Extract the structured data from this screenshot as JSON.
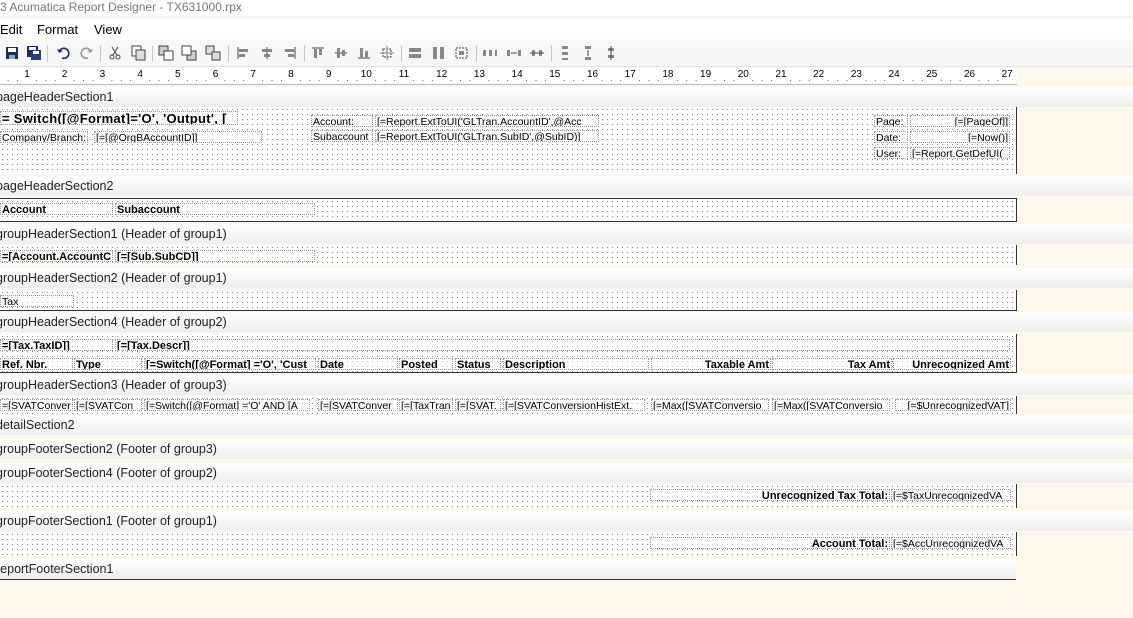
{
  "window": {
    "title": "3 Acumatica Report Designer - TX631000.rpx"
  },
  "menu": [
    "Edit",
    "Format",
    "View"
  ],
  "ruler": {
    "numbers": [
      "1",
      "2",
      "3",
      "4",
      "5",
      "6",
      "7",
      "8",
      "9",
      "10",
      "11",
      "12",
      "13",
      "14",
      "15",
      "16",
      "17",
      "18",
      "19",
      "20",
      "21",
      "22",
      "23",
      "24",
      "25",
      "26",
      "27"
    ]
  },
  "sections": {
    "pageHeader1": {
      "label": "pageHeaderSection1",
      "fields": {
        "switch": "=  Switch([@Format]='O',  'Output',  [",
        "company_label": "Company/Branch:",
        "company_val": "[=[@OrgBAccountID]]",
        "account_label": "Account:",
        "account_val": "[=Report.ExtToUI('GLTran.AccountID',@Acc",
        "subaccount_label": "Subaccount",
        "subaccount_val": "[=Report.ExtToUI('GLTran.SubID',@SubID)]",
        "page_label": "Page:",
        "page_val": "[=[PageOf]]",
        "date_label": "Date:",
        "date_val": "[=Now()]",
        "user_label": "User:",
        "user_val": "[=Report.GetDefUI("
      }
    },
    "pageHeader2": {
      "label": "pageHeaderSection2",
      "account": "Account",
      "subaccount": "Subaccount"
    },
    "group1Header1": {
      "label": "groupHeaderSection1 (Header of group1)",
      "f1": "=[Account.AccountC",
      "f2": "[=[Sub.SubCD]]"
    },
    "group1Header2": {
      "label": "groupHeaderSection2 (Header of group1)",
      "tax": "Tax"
    },
    "group2Header4": {
      "label": "groupHeaderSection4 (Header of group2)",
      "taxid": "=[Tax.TaxID]]",
      "descr": "[=[Tax.Descr]]",
      "columns": {
        "ref": "Ref. Nbr.",
        "type": "Type",
        "switch": "[=Switch([@Format] ='O', 'Cust",
        "date": "Date",
        "posted": "Posted",
        "status": "Status",
        "description": "Description",
        "taxable": "Taxable Amt",
        "taxamt": "Tax Amt",
        "unrec": "Unrecognized Amt"
      }
    },
    "group3Header3": {
      "label": "groupHeaderSection3 (Header of group3)",
      "f1": "=[SVATConver",
      "f2": "[=[SVATCon",
      "f3": "[=Switch([@Format] ='O' AND [A",
      "f4": "[=[SVATConver",
      "f5": "[=[TaxTran",
      "f6": "[=[SVAT.",
      "f7": "[=[SVATConversionHistExt.",
      "f8": "[=Max([SVATConversio",
      "f9": "[=Max([SVATConversio",
      "f10": "[=$UnrecognizedVAT]"
    },
    "detail2": {
      "label": "detailSection2"
    },
    "group3Footer2": {
      "label": "groupFooterSection2 (Footer of group3)"
    },
    "group2Footer4": {
      "label": "groupFooterSection4 (Footer of group2)",
      "total_label": "Unrecognized Tax Total:",
      "total_val": "[=$TaxUnrecognizedVA"
    },
    "group1Footer1": {
      "label": "groupFooterSection1 (Footer of group1)",
      "total_label": "Account Total:",
      "total_val": "[=$AccUnrecognizedVA"
    },
    "reportFooter1": {
      "label": "reportFooterSection1"
    }
  }
}
